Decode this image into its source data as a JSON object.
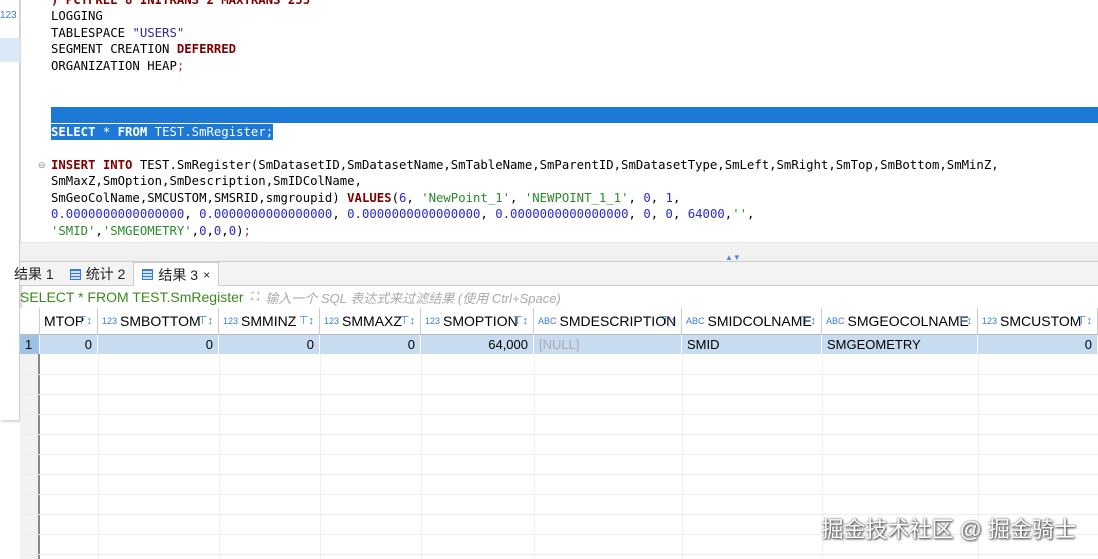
{
  "editor": {
    "lines": [
      [
        {
          "t": ") PCTFREE 8 INITRANS 2 MAXTRANS 255",
          "c": "kw"
        }
      ],
      [
        {
          "t": "LOGGING",
          "c": ""
        }
      ],
      [
        {
          "t": "TABLESPACE ",
          "c": ""
        },
        {
          "t": "\"USERS\"",
          "c": "q"
        }
      ],
      [
        {
          "t": "SEGMENT CREATION ",
          "c": ""
        },
        {
          "t": "DEFERRED",
          "c": "kw"
        }
      ],
      [
        {
          "t": "ORGANIZATION HEAP",
          "c": ""
        },
        {
          "t": ";",
          "c": "pun"
        }
      ],
      [],
      [],
      [],
      [
        {
          "t": "SELECT",
          "c": "kw"
        },
        {
          "t": " * ",
          "c": ""
        },
        {
          "t": "FROM",
          "c": "kw"
        },
        {
          "t": " TEST.SmRegister;",
          "c": ""
        }
      ],
      [],
      [
        {
          "t": "INSERT INTO",
          "c": "kw"
        },
        {
          "t": " TEST.SmRegister(SmDatasetID,SmDatasetName,SmTableName,SmParentID,SmDatasetType,SmLeft,SmRight,SmTop,SmBottom,SmMinZ,",
          "c": ""
        }
      ],
      [
        {
          "t": "SmMaxZ,SmOption,SmDescription,SmIDColName,",
          "c": ""
        }
      ],
      [
        {
          "t": "SmGeoColName,SMCUSTOM,SMSRID,smgroupid) ",
          "c": ""
        },
        {
          "t": "VALUES",
          "c": "kw"
        },
        {
          "t": "(",
          "c": ""
        },
        {
          "t": "6",
          "c": "num"
        },
        {
          "t": ", ",
          "c": ""
        },
        {
          "t": "'NewPoint_1'",
          "c": "str"
        },
        {
          "t": ", ",
          "c": ""
        },
        {
          "t": "'NEWPOINT_1_1'",
          "c": "str"
        },
        {
          "t": ", ",
          "c": ""
        },
        {
          "t": "0",
          "c": "num"
        },
        {
          "t": ", ",
          "c": ""
        },
        {
          "t": "1",
          "c": "num"
        },
        {
          "t": ",",
          "c": ""
        }
      ],
      [
        {
          "t": "0.0000000000000000",
          "c": "num"
        },
        {
          "t": ", ",
          "c": ""
        },
        {
          "t": "0.0000000000000000",
          "c": "num"
        },
        {
          "t": ", ",
          "c": ""
        },
        {
          "t": "0.0000000000000000",
          "c": "num"
        },
        {
          "t": ", ",
          "c": ""
        },
        {
          "t": "0.0000000000000000",
          "c": "num"
        },
        {
          "t": ", ",
          "c": ""
        },
        {
          "t": "0",
          "c": "num"
        },
        {
          "t": ", ",
          "c": ""
        },
        {
          "t": "0",
          "c": "num"
        },
        {
          "t": ", ",
          "c": ""
        },
        {
          "t": "64000",
          "c": "num"
        },
        {
          "t": ",",
          "c": ""
        },
        {
          "t": "''",
          "c": "str"
        },
        {
          "t": ",",
          "c": ""
        }
      ],
      [
        {
          "t": "'SMID'",
          "c": "str"
        },
        {
          "t": ",",
          "c": ""
        },
        {
          "t": "'SMGEOMETRY'",
          "c": "str"
        },
        {
          "t": ",",
          "c": ""
        },
        {
          "t": "0",
          "c": "num"
        },
        {
          "t": ",",
          "c": ""
        },
        {
          "t": "0",
          "c": "num"
        },
        {
          "t": ",",
          "c": ""
        },
        {
          "t": "0",
          "c": "num"
        },
        {
          "t": ")",
          "c": ""
        },
        {
          "t": ";",
          "c": "pun"
        }
      ]
    ],
    "selected_line": 8
  },
  "left_panel": {
    "type_label": "123"
  },
  "tabs": [
    {
      "label": "结果 1",
      "icon": "table-icon"
    },
    {
      "label": "统计 2",
      "icon": "table-icon"
    },
    {
      "label": "结果 3",
      "icon": "table-icon",
      "active": true,
      "close": "×"
    }
  ],
  "filter": {
    "query": "SELECT * FROM TEST.SmRegister",
    "placeholder": "输入一个 SQL 表达式来过滤结果 (使用 Ctrl+Space)"
  },
  "grid": {
    "columns": [
      {
        "name": "MTOP",
        "type": ""
      },
      {
        "name": "SMBOTTOM",
        "type": "123"
      },
      {
        "name": "SMMINZ",
        "type": "123"
      },
      {
        "name": "SMMAXZ",
        "type": "123"
      },
      {
        "name": "SMOPTION",
        "type": "123"
      },
      {
        "name": "SMDESCRIPTION",
        "type": "ABC"
      },
      {
        "name": "SMIDCOLNAME",
        "type": "ABC"
      },
      {
        "name": "SMGEOCOLNAME",
        "type": "ABC"
      },
      {
        "name": "SMCUSTOM",
        "type": "123"
      }
    ],
    "rows": [
      {
        "num": "1",
        "cells": [
          "0",
          "0",
          "0",
          "0",
          "64,000",
          "[NULL]",
          "SMID",
          "SMGEOMETRY",
          "0"
        ]
      }
    ]
  },
  "watermark": "掘金技术社区 @ 掘金骑士"
}
